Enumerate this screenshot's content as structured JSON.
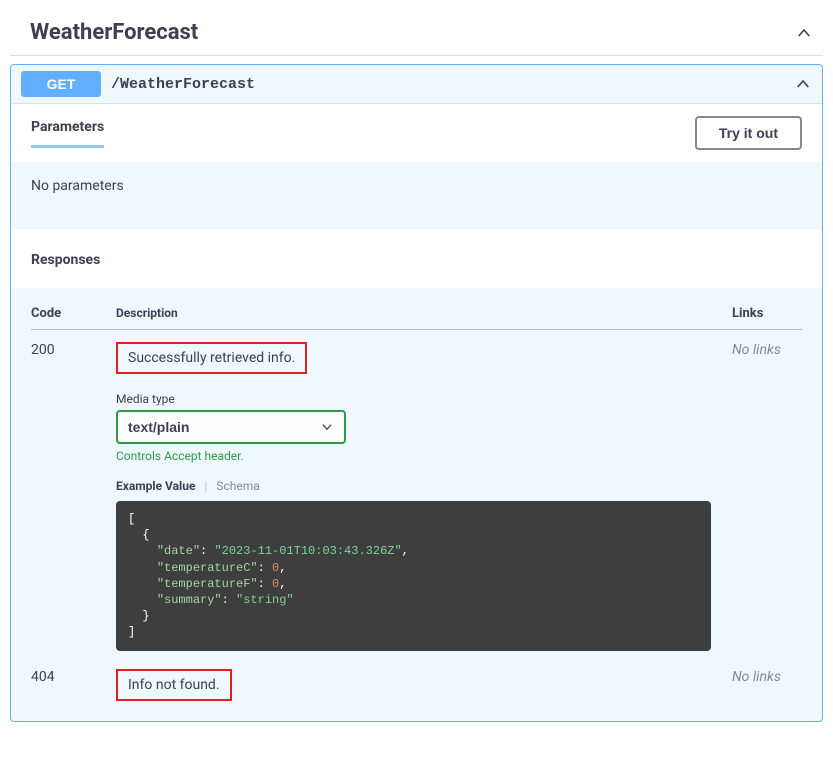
{
  "section": {
    "title": "WeatherForecast"
  },
  "endpoint": {
    "method": "GET",
    "path": "/WeatherForecast"
  },
  "parameters": {
    "heading": "Parameters",
    "try_button": "Try it out",
    "empty": "No parameters"
  },
  "responses": {
    "heading": "Responses",
    "columns": {
      "code": "Code",
      "description": "Description",
      "links": "Links"
    },
    "rows": [
      {
        "code": "200",
        "description": "Successfully retrieved info.",
        "links": "No links",
        "media_type_label": "Media type",
        "media_type_value": "text/plain",
        "media_hint": "Controls Accept header.",
        "example_tab_active": "Example Value",
        "example_tab_inactive": "Schema",
        "example_json": {
          "date_key": "\"date\"",
          "date_val": "\"2023-11-01T10:03:43.326Z\"",
          "tc_key": "\"temperatureC\"",
          "tc_val": "0",
          "tf_key": "\"temperatureF\"",
          "tf_val": "0",
          "sum_key": "\"summary\"",
          "sum_val": "\"string\""
        }
      },
      {
        "code": "404",
        "description": "Info not found.",
        "links": "No links"
      }
    ]
  }
}
